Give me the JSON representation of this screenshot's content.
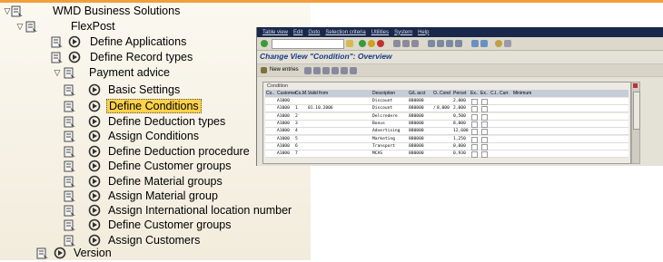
{
  "tree": {
    "items": [
      {
        "label": "WMD Business Solutions",
        "twisty": "▽",
        "exe": false
      },
      {
        "label": "FlexPost",
        "twisty": "▽",
        "exe": false
      },
      {
        "label": "Define Applications",
        "twisty": "",
        "exe": true
      },
      {
        "label": "Define Record types",
        "twisty": "",
        "exe": true
      },
      {
        "label": "Payment advice",
        "twisty": "▽",
        "exe": false
      },
      {
        "label": "Basic Settings",
        "twisty": "",
        "exe": true
      },
      {
        "label": "Define Conditions",
        "twisty": "",
        "exe": true,
        "selected": true
      },
      {
        "label": "Define Deduction types",
        "twisty": "",
        "exe": true
      },
      {
        "label": "Assign Conditions",
        "twisty": "",
        "exe": true
      },
      {
        "label": "Define Deduction procedure",
        "twisty": "",
        "exe": true
      },
      {
        "label": "Define Customer groups",
        "twisty": "",
        "exe": true
      },
      {
        "label": "Define Material groups",
        "twisty": "",
        "exe": true
      },
      {
        "label": "Assign Material group",
        "twisty": "",
        "exe": true
      },
      {
        "label": "Assign International location number",
        "twisty": "",
        "exe": true
      },
      {
        "label": "Define Customer groups",
        "twisty": "",
        "exe": true
      },
      {
        "label": "Assign Customers",
        "twisty": "",
        "exe": true
      },
      {
        "label": "Version",
        "twisty": "",
        "exe": true
      }
    ]
  },
  "sap": {
    "menu": [
      "Table view",
      "Edit",
      "Goto",
      "Selection criteria",
      "Utilities",
      "System",
      "Help"
    ],
    "title": "Change View \"Condition\": Overview",
    "new_entries": "New entries",
    "table_caption": "Condition",
    "columns": [
      "Co..",
      "Customer",
      "Co..",
      "M..",
      "Valid from",
      "Description",
      "G/L acct",
      "O..",
      "Cond",
      "Percet",
      "Ex..",
      "Ex..",
      "C..",
      "I..",
      "Curr.",
      "Minimum"
    ],
    "rows": [
      {
        "customer": "A1000",
        "cond": "",
        "m": "",
        "valid_from": "",
        "desc": "Discount",
        "gl": "880000",
        "o": "",
        "amount": "",
        "percent": "2,000"
      },
      {
        "customer": "A1000",
        "cond": "1",
        "m": "",
        "valid_from": "01.10.2006",
        "desc": "Discount",
        "gl": "880000",
        "o": "/",
        "amount": "8,000",
        "percent": "2,000"
      },
      {
        "customer": "A1000",
        "cond": "2",
        "m": "",
        "valid_from": "",
        "desc": "Delcredere",
        "gl": "880000",
        "o": "",
        "amount": "",
        "percent": "0,500"
      },
      {
        "customer": "A1000",
        "cond": "3",
        "m": "",
        "valid_from": "",
        "desc": "Bonus",
        "gl": "880000",
        "o": "",
        "amount": "",
        "percent": "8,000"
      },
      {
        "customer": "A1000",
        "cond": "4",
        "m": "",
        "valid_from": "",
        "desc": "Advertising",
        "gl": "880000",
        "o": "",
        "amount": "",
        "percent": "12,600"
      },
      {
        "customer": "A1000",
        "cond": "5",
        "m": "",
        "valid_from": "",
        "desc": "Marketing",
        "gl": "880000",
        "o": "",
        "amount": "",
        "percent": "1,250"
      },
      {
        "customer": "A1000",
        "cond": "6",
        "m": "",
        "valid_from": "",
        "desc": "Transport",
        "gl": "880000",
        "o": "",
        "amount": "",
        "percent": "0,000"
      },
      {
        "customer": "A1000",
        "cond": "7",
        "m": "",
        "valid_from": "",
        "desc": "MCAS",
        "gl": "880000",
        "o": "",
        "amount": "",
        "percent": "0,930"
      }
    ]
  },
  "colors": {
    "tree_bg": "#f7f2e4",
    "selected": "#ffd24a",
    "sap_menubar": "#19284a",
    "title": "#183a82"
  }
}
